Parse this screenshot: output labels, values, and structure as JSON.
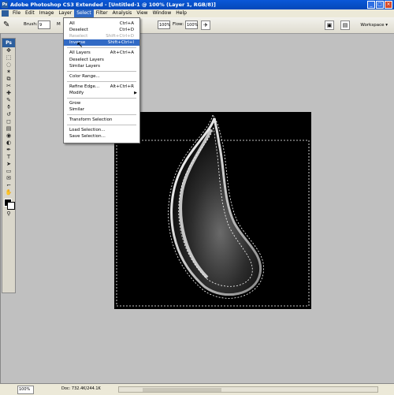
{
  "titlebar": {
    "title": "Adobe Photoshop CS3 Extended - [Untitled-1 @ 100% (Layer 1, RGB/8)]",
    "logo_text": "Ps"
  },
  "menubar": {
    "items": [
      "File",
      "Edit",
      "Image",
      "Layer",
      "Select",
      "Filter",
      "Analysis",
      "View",
      "Window",
      "Help"
    ],
    "active": "Select"
  },
  "options": {
    "brush_label": "Brush:",
    "brush_size": "9",
    "mode_label": "M",
    "opacity_label": "Flow:",
    "opacity_value": "100%",
    "pressure_value": "100%",
    "workspace": "Workspace"
  },
  "toolbox": {
    "logo": "Ps",
    "tools": [
      "move-tool",
      "marquee-tool",
      "lasso-tool",
      "magic-wand-tool",
      "crop-tool",
      "slice-tool",
      "healing-tool",
      "brush-tool",
      "stamp-tool",
      "history-brush-tool",
      "eraser-tool",
      "gradient-tool",
      "blur-tool",
      "dodge-tool",
      "pen-tool",
      "type-tool",
      "path-select-tool",
      "shape-tool",
      "notes-tool",
      "eyedropper-tool",
      "hand-tool",
      "zoom-tool"
    ],
    "glyphs": [
      "✥",
      "⬚",
      "◌",
      "✶",
      "⧉",
      "✂",
      "✚",
      "✎",
      "⚱",
      "↺",
      "◻",
      "▤",
      "◉",
      "◐",
      "✒",
      "T",
      "➤",
      "▭",
      "✉",
      "⌐",
      "✋",
      "⚲"
    ]
  },
  "select_menu": {
    "items": [
      {
        "label": "All",
        "shortcut": "Ctrl+A",
        "state": "normal"
      },
      {
        "label": "Deselect",
        "shortcut": "Ctrl+D",
        "state": "normal"
      },
      {
        "label": "Reselect",
        "shortcut": "Shift+Ctrl+D",
        "state": "disabled"
      },
      {
        "label": "Inverse",
        "shortcut": "Shift+Ctrl+I",
        "state": "highlighted"
      },
      {
        "label": "All Layers",
        "shortcut": "Alt+Ctrl+A",
        "state": "normal"
      },
      {
        "label": "Deselect Layers",
        "shortcut": "",
        "state": "normal"
      },
      {
        "label": "Similar Layers",
        "shortcut": "",
        "state": "normal"
      },
      {
        "label": "Color Range...",
        "shortcut": "",
        "state": "normal"
      },
      {
        "label": "Refine Edge...",
        "shortcut": "Alt+Ctrl+R",
        "state": "normal"
      },
      {
        "label": "Modify",
        "shortcut": "",
        "state": "submenu"
      },
      {
        "label": "Grow",
        "shortcut": "",
        "state": "normal"
      },
      {
        "label": "Similar",
        "shortcut": "",
        "state": "normal"
      },
      {
        "label": "Transform Selection",
        "shortcut": "",
        "state": "normal"
      },
      {
        "label": "Load Selection...",
        "shortcut": "",
        "state": "normal"
      },
      {
        "label": "Save Selection...",
        "shortcut": "",
        "state": "normal"
      }
    ]
  },
  "status": {
    "zoom": "100%",
    "doc": "Doc: 732.4K/244.1K"
  },
  "colors": {
    "accent": "#316ac5",
    "title": "#0a58d8",
    "workspace_bg": "#c0c0c0",
    "canvas": "#000000"
  }
}
